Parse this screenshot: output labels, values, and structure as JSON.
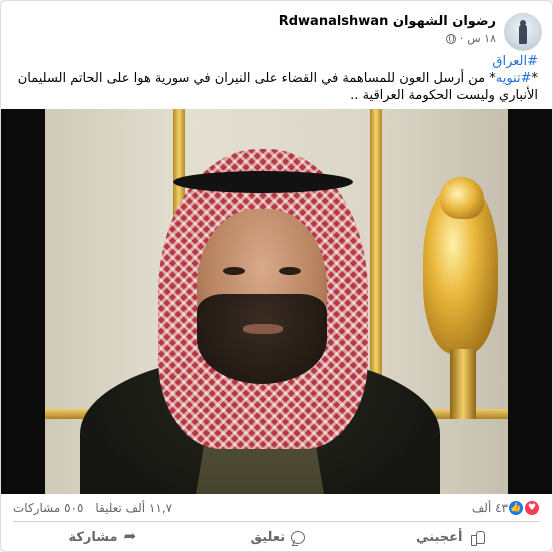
{
  "post": {
    "author": "رضوان الشهوان Rdwanalshwan",
    "timestamp": "١٨ س",
    "privacy_icon": "globe-icon",
    "hashtag_line": "#العراق",
    "text_tag": "#تنويه",
    "text_body": "* من أرسل العون للمساهمة في القضاء على النيران في سورية هوا على الحاتم السليمان الأنباري وليست الحكومة العراقية ..",
    "text_prefix": "*"
  },
  "reactions": {
    "count": "٤٣ ألف",
    "types": [
      "like-icon",
      "love-icon"
    ],
    "comments": "١١,٧ ألف تعليقا",
    "shares": "٥٠٥ مشاركات"
  },
  "actions": {
    "like": "أعجبني",
    "comment": "تعليق",
    "share": "مشاركة"
  },
  "colors": {
    "accent": "#1877f2",
    "hashtag": "#216fdb",
    "love": "#f33e58",
    "muted": "#65676b"
  }
}
